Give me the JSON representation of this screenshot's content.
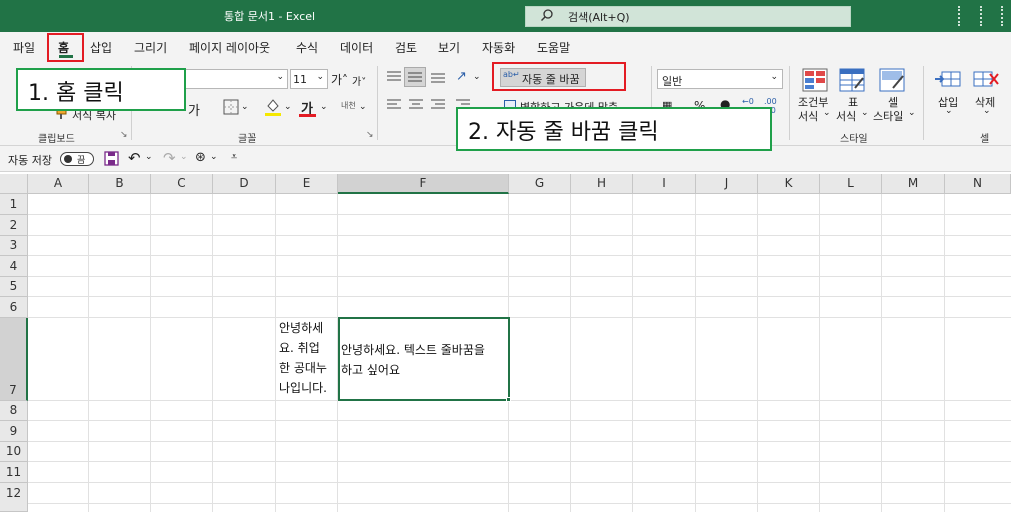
{
  "window": {
    "title": "통합 문서1  -  Excel",
    "search_placeholder": "검색(Alt+Q)"
  },
  "tabs": [
    "파일",
    "홈",
    "삽입",
    "그리기",
    "페이지 레이아웃",
    "수식",
    "데이터",
    "검토",
    "보기",
    "자동화",
    "도움말"
  ],
  "ribbon": {
    "clipboard_label": "클립보드",
    "format_painter": "서식 복사",
    "font_size": "11",
    "font_label": "글꼴",
    "wrap_text": "자동 줄 바꿈",
    "merge_center": "병합하고 가운데 맞춤",
    "number_format": "일반",
    "conditional_format_1": "조건부",
    "conditional_format_2": "서식",
    "format_table_1": "표",
    "format_table_2": "서식",
    "cell_styles_1": "셀",
    "cell_styles_2": "스타일",
    "styles_label": "스타일",
    "insert": "삽입",
    "delete": "삭제",
    "cells_label": "셀"
  },
  "qat": {
    "autosave_label": "자동 저장",
    "autosave_state": "끔"
  },
  "columns": [
    "A",
    "B",
    "C",
    "D",
    "E",
    "F",
    "G",
    "H",
    "I",
    "J",
    "K",
    "L",
    "M",
    "N"
  ],
  "rows": [
    "1",
    "2",
    "3",
    "4",
    "5",
    "6",
    "7",
    "8",
    "9",
    "10",
    "11",
    "12"
  ],
  "cells": {
    "E7": "안녕하세\n요. 취업\n한 공대누\n나입니다.",
    "F7": "안녕하세요. 텍스트 줄바꿈을\n하고 싶어요"
  },
  "annotations": {
    "step1": "1. 홈 클릭",
    "step2": "2. 자동 줄 바꿈 클릭"
  },
  "colors": {
    "excel_green": "#217346",
    "annotation_green": "#1fa04a",
    "highlight_red": "#e31b23"
  }
}
